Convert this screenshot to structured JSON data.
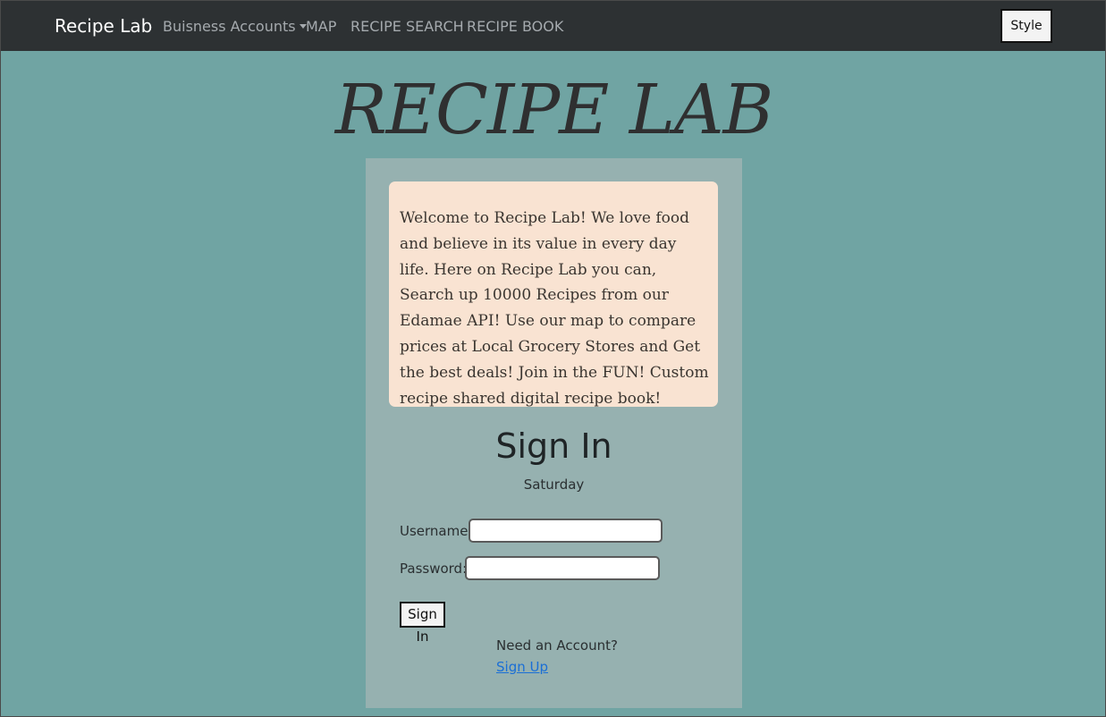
{
  "nav": {
    "brand": "Recipe Lab",
    "items": [
      {
        "label": "Buisness Accounts",
        "dropdown": true
      },
      {
        "label": "MAP"
      },
      {
        "label": "RECIPE SEARCH"
      },
      {
        "label": "RECIPE BOOK"
      }
    ],
    "style_button": "Style"
  },
  "hero": {
    "title": "RECIPE LAB"
  },
  "welcome": {
    "text": "Welcome to Recipe Lab! We love food and believe in its value in every day life. Here on Recipe Lab you can, Search up 10000 Recipes from our Edamae API! Use our map to compare prices at Local Grocery Stores and Get the best deals! Join in the FUN! Custom recipe shared digital recipe book!"
  },
  "signin": {
    "title": "Sign In",
    "day": "Saturday",
    "username_label": "Username:",
    "username_value": "",
    "password_label": "Password:",
    "password_value": "",
    "submit_label": "Sign In",
    "need_account": "Need an Account?",
    "signup_link": "Sign Up"
  },
  "colors": {
    "page_bg": "#70a4a3",
    "navbar_bg": "#2d3133",
    "panel_bg": "#96b1b0",
    "welcome_bg": "#f9e3d2",
    "link": "#1a6fd6"
  }
}
